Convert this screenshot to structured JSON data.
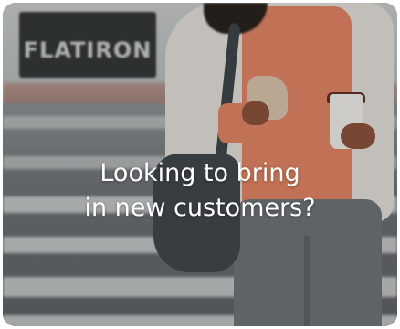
{
  "hero": {
    "headline_line1": "Looking to bring",
    "headline_line2": "in new customers?",
    "background_image": "woman-crossing-street-with-coffee-and-backpack",
    "store_sign": "FLATIRON",
    "text_color": "#ffffff"
  }
}
